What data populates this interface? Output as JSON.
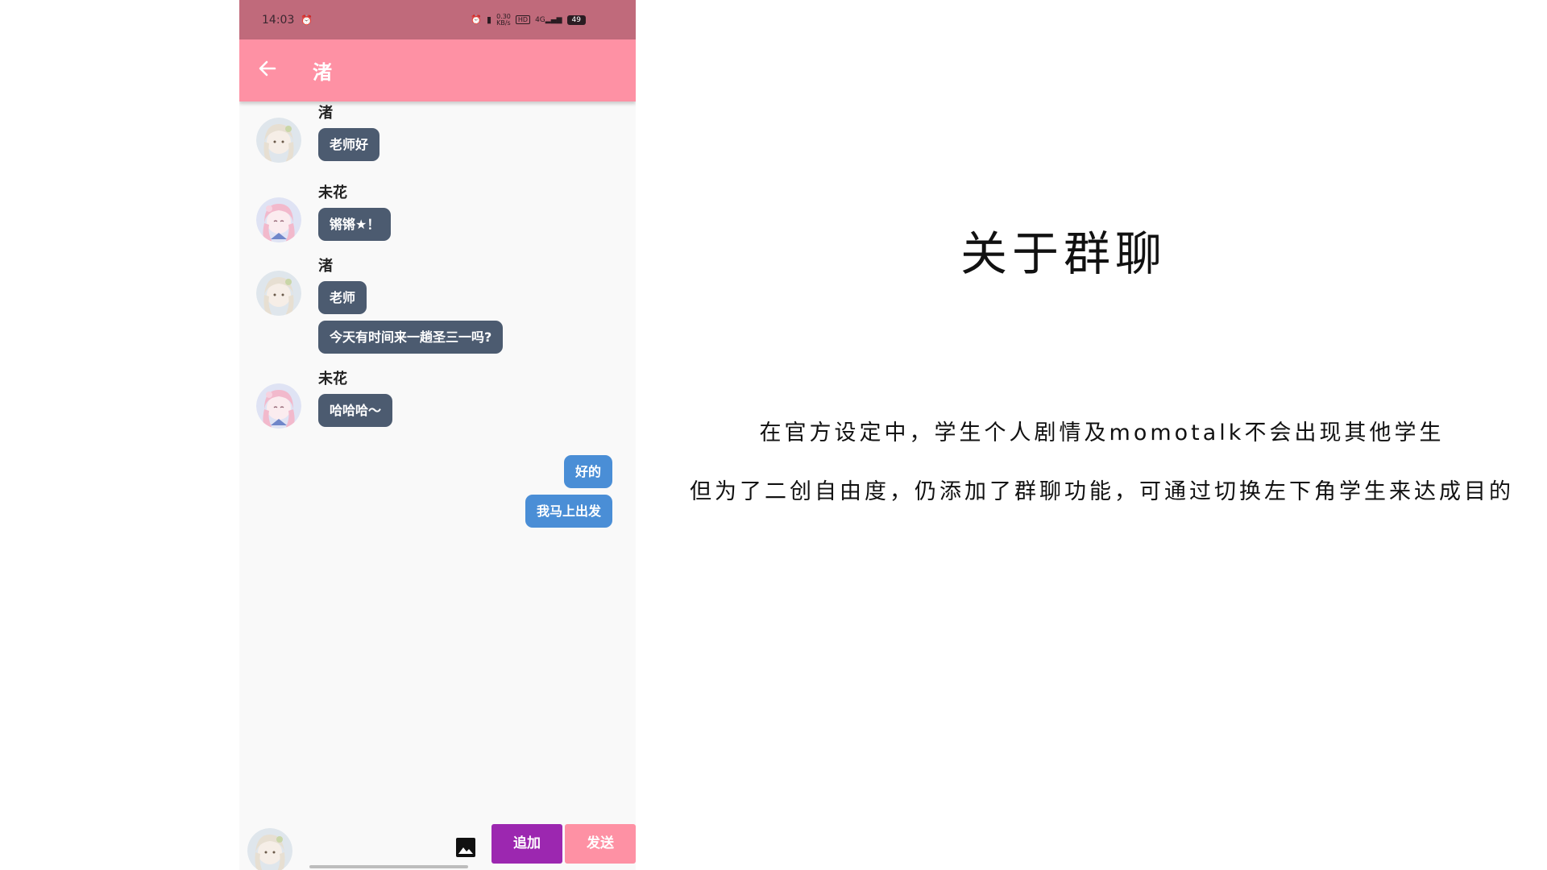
{
  "status_bar": {
    "time": "14:03",
    "speed": "0.30\nKB/s",
    "signal": "4G",
    "hd": "HD",
    "battery": "49"
  },
  "appbar": {
    "title": "渚"
  },
  "messages": [
    {
      "sender": "渚",
      "texts": [
        "老师好"
      ]
    },
    {
      "sender": "未花",
      "texts": [
        "锵锵★！"
      ]
    },
    {
      "sender": "渚",
      "texts": [
        "老师",
        "今天有时间来一趟圣三一吗?"
      ]
    },
    {
      "sender": "未花",
      "texts": [
        "哈哈哈～"
      ]
    }
  ],
  "my_messages": [
    "好的",
    "我马上出发"
  ],
  "bottom": {
    "add_label": "追加",
    "send_label": "发送"
  },
  "slide": {
    "headline": "关于群聊",
    "line1": "在官方设定中，学生个人剧情及momotalk不会出现其他学生",
    "line2": "但为了二创自由度，仍添加了群聊功能，可通过切换左下角学生来达成目的"
  },
  "colors": {
    "status_bar": "#c06a7b",
    "appbar": "#fe91a4",
    "student_bubble": "#4c5b70",
    "my_bubble": "#4a8ed6",
    "add_button": "#9c27b0",
    "send_button": "#fe91a4"
  }
}
